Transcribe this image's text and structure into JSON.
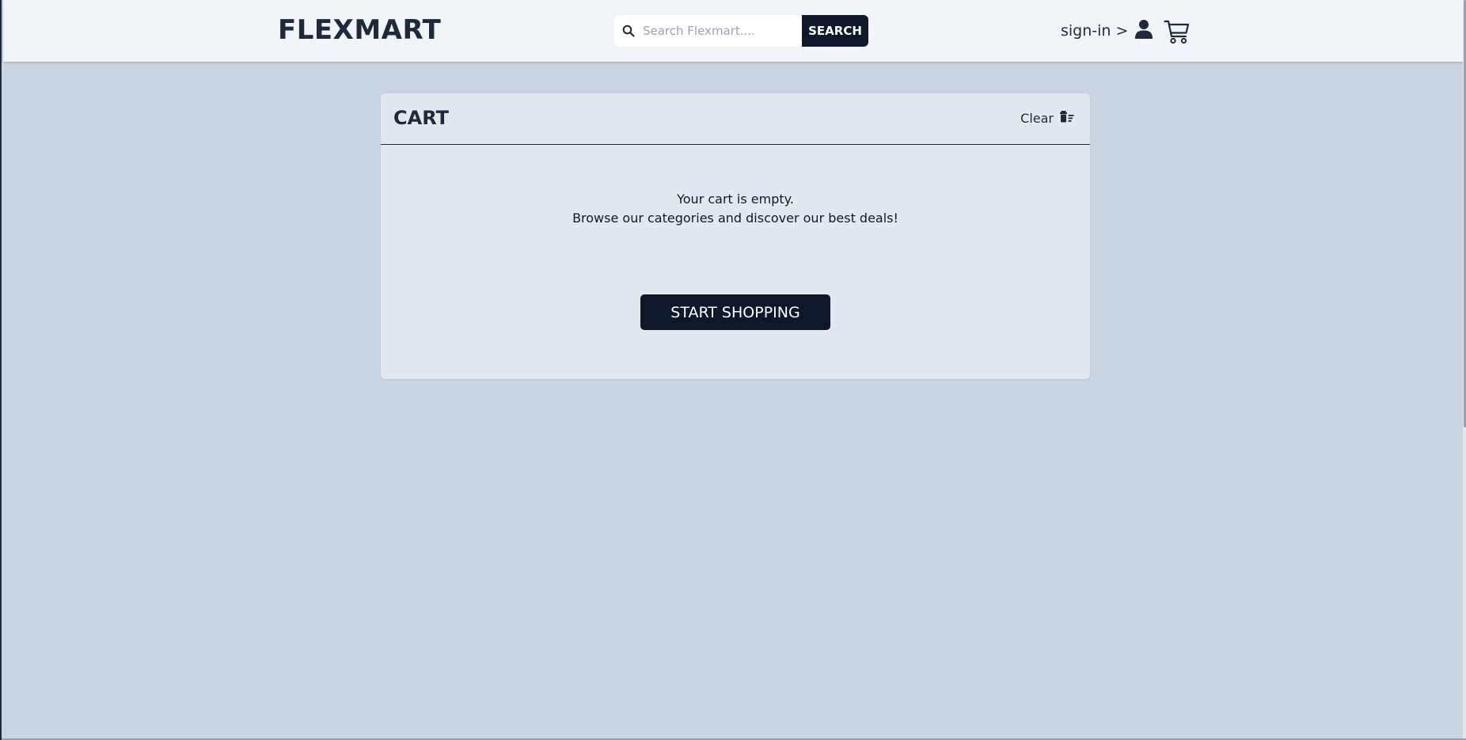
{
  "header": {
    "logo": "FLEXMART",
    "search": {
      "placeholder": "Search Flexmart....",
      "value": "",
      "button_label": "SEARCH"
    },
    "signin_label": "sign-in >",
    "icons": {
      "search": "search-icon",
      "user": "user-icon",
      "cart": "shopping-cart-icon"
    }
  },
  "cart": {
    "title": "CART",
    "clear_label": "Clear",
    "clear_icon": "trash-icon",
    "empty_line1": "Your cart is empty.",
    "empty_line2": "Browse our categories and discover our best deals!",
    "start_shopping_label": "START SHOPPING"
  },
  "colors": {
    "page_background": "#cbd5e1",
    "header_background": "#f1f5f9",
    "card_background": "#e2e8f0",
    "primary_dark": "#0f172a"
  }
}
